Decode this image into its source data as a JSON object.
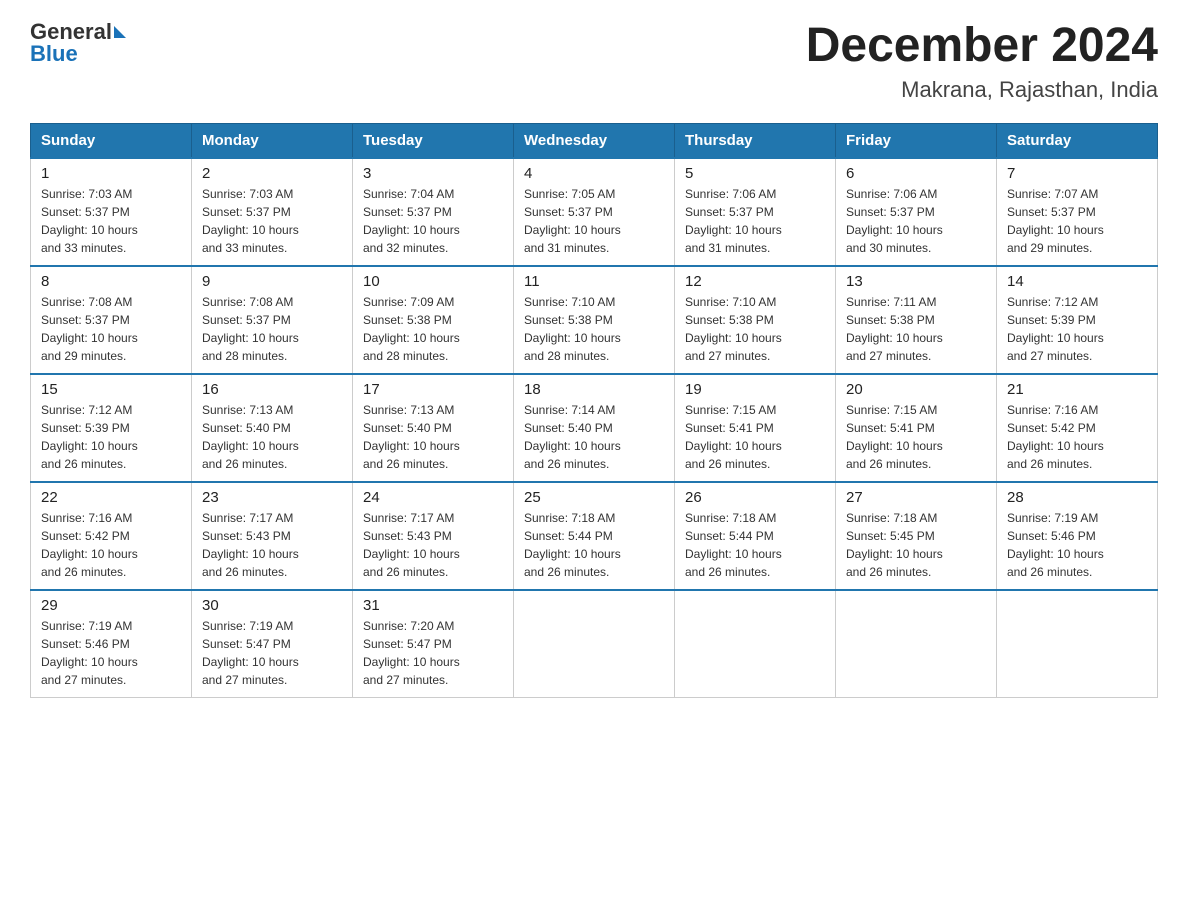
{
  "header": {
    "logo_general": "General",
    "logo_blue": "Blue",
    "month_title": "December 2024",
    "location": "Makrana, Rajasthan, India"
  },
  "days_of_week": [
    "Sunday",
    "Monday",
    "Tuesday",
    "Wednesday",
    "Thursday",
    "Friday",
    "Saturday"
  ],
  "weeks": [
    [
      {
        "day": "1",
        "sunrise": "7:03 AM",
        "sunset": "5:37 PM",
        "daylight": "10 hours and 33 minutes."
      },
      {
        "day": "2",
        "sunrise": "7:03 AM",
        "sunset": "5:37 PM",
        "daylight": "10 hours and 33 minutes."
      },
      {
        "day": "3",
        "sunrise": "7:04 AM",
        "sunset": "5:37 PM",
        "daylight": "10 hours and 32 minutes."
      },
      {
        "day": "4",
        "sunrise": "7:05 AM",
        "sunset": "5:37 PM",
        "daylight": "10 hours and 31 minutes."
      },
      {
        "day": "5",
        "sunrise": "7:06 AM",
        "sunset": "5:37 PM",
        "daylight": "10 hours and 31 minutes."
      },
      {
        "day": "6",
        "sunrise": "7:06 AM",
        "sunset": "5:37 PM",
        "daylight": "10 hours and 30 minutes."
      },
      {
        "day": "7",
        "sunrise": "7:07 AM",
        "sunset": "5:37 PM",
        "daylight": "10 hours and 29 minutes."
      }
    ],
    [
      {
        "day": "8",
        "sunrise": "7:08 AM",
        "sunset": "5:37 PM",
        "daylight": "10 hours and 29 minutes."
      },
      {
        "day": "9",
        "sunrise": "7:08 AM",
        "sunset": "5:37 PM",
        "daylight": "10 hours and 28 minutes."
      },
      {
        "day": "10",
        "sunrise": "7:09 AM",
        "sunset": "5:38 PM",
        "daylight": "10 hours and 28 minutes."
      },
      {
        "day": "11",
        "sunrise": "7:10 AM",
        "sunset": "5:38 PM",
        "daylight": "10 hours and 28 minutes."
      },
      {
        "day": "12",
        "sunrise": "7:10 AM",
        "sunset": "5:38 PM",
        "daylight": "10 hours and 27 minutes."
      },
      {
        "day": "13",
        "sunrise": "7:11 AM",
        "sunset": "5:38 PM",
        "daylight": "10 hours and 27 minutes."
      },
      {
        "day": "14",
        "sunrise": "7:12 AM",
        "sunset": "5:39 PM",
        "daylight": "10 hours and 27 minutes."
      }
    ],
    [
      {
        "day": "15",
        "sunrise": "7:12 AM",
        "sunset": "5:39 PM",
        "daylight": "10 hours and 26 minutes."
      },
      {
        "day": "16",
        "sunrise": "7:13 AM",
        "sunset": "5:40 PM",
        "daylight": "10 hours and 26 minutes."
      },
      {
        "day": "17",
        "sunrise": "7:13 AM",
        "sunset": "5:40 PM",
        "daylight": "10 hours and 26 minutes."
      },
      {
        "day": "18",
        "sunrise": "7:14 AM",
        "sunset": "5:40 PM",
        "daylight": "10 hours and 26 minutes."
      },
      {
        "day": "19",
        "sunrise": "7:15 AM",
        "sunset": "5:41 PM",
        "daylight": "10 hours and 26 minutes."
      },
      {
        "day": "20",
        "sunrise": "7:15 AM",
        "sunset": "5:41 PM",
        "daylight": "10 hours and 26 minutes."
      },
      {
        "day": "21",
        "sunrise": "7:16 AM",
        "sunset": "5:42 PM",
        "daylight": "10 hours and 26 minutes."
      }
    ],
    [
      {
        "day": "22",
        "sunrise": "7:16 AM",
        "sunset": "5:42 PM",
        "daylight": "10 hours and 26 minutes."
      },
      {
        "day": "23",
        "sunrise": "7:17 AM",
        "sunset": "5:43 PM",
        "daylight": "10 hours and 26 minutes."
      },
      {
        "day": "24",
        "sunrise": "7:17 AM",
        "sunset": "5:43 PM",
        "daylight": "10 hours and 26 minutes."
      },
      {
        "day": "25",
        "sunrise": "7:18 AM",
        "sunset": "5:44 PM",
        "daylight": "10 hours and 26 minutes."
      },
      {
        "day": "26",
        "sunrise": "7:18 AM",
        "sunset": "5:44 PM",
        "daylight": "10 hours and 26 minutes."
      },
      {
        "day": "27",
        "sunrise": "7:18 AM",
        "sunset": "5:45 PM",
        "daylight": "10 hours and 26 minutes."
      },
      {
        "day": "28",
        "sunrise": "7:19 AM",
        "sunset": "5:46 PM",
        "daylight": "10 hours and 26 minutes."
      }
    ],
    [
      {
        "day": "29",
        "sunrise": "7:19 AM",
        "sunset": "5:46 PM",
        "daylight": "10 hours and 27 minutes."
      },
      {
        "day": "30",
        "sunrise": "7:19 AM",
        "sunset": "5:47 PM",
        "daylight": "10 hours and 27 minutes."
      },
      {
        "day": "31",
        "sunrise": "7:20 AM",
        "sunset": "5:47 PM",
        "daylight": "10 hours and 27 minutes."
      },
      null,
      null,
      null,
      null
    ]
  ]
}
